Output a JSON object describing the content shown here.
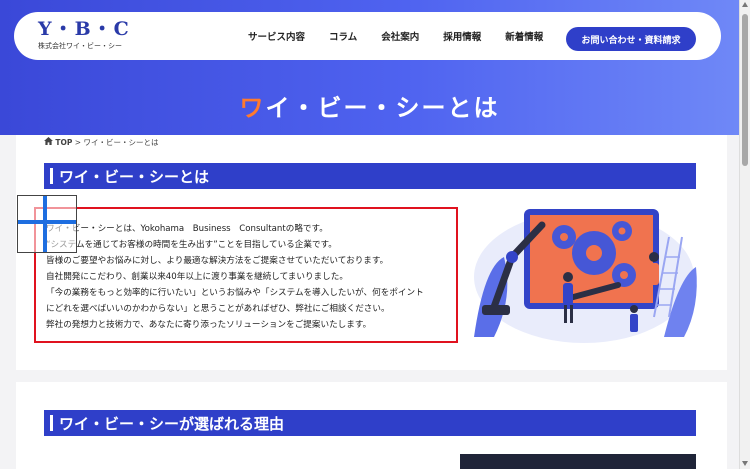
{
  "header": {
    "logo_main": "Y・B・C",
    "logo_sub": "株式会社ワイ・ビー・シー",
    "nav": [
      "サービス内容",
      "コラム",
      "会社案内",
      "採用情報",
      "新着情報"
    ],
    "contact_label": "お問い合わせ・資料請求"
  },
  "hero": {
    "title_accent": "ワ",
    "title_rest": "イ・ビー・シーとは"
  },
  "breadcrumb": {
    "home": "TOP",
    "separator": ">",
    "current": "ワイ・ビー・シーとは"
  },
  "about": {
    "heading": "ワイ・ビー・シーとは",
    "lines": [
      "ワイ・ビー・シーとは、Yokohama　Business　Consultantの略です。",
      "“システムを通じてお客様の時間を生み出す”ことを目指している企業です。",
      "皆様のご要望やお悩みに対し、より最適な解決方法をご提案させていただいております。",
      "自社開発にこだわり、創業以来40年以上に渡り事業を継続してまいりました。",
      "「今の業務をもっと効率的に行いたい」というお悩みや「システムを導入したいが、何をポイント",
      "にどれを選べばいいのかわからない」と思うことがあればぜひ、弊社にご相談ください。",
      "弊社の発想力と技術力で、あなたに寄り添ったソリューションをご提案いたします。"
    ]
  },
  "reasons": {
    "heading": "ワイ・ビー・シーが選ばれる理由"
  },
  "colors": {
    "brand_blue": "#2f3fc9",
    "accent_orange": "#ff7a2e",
    "highlight_red": "#e0121f"
  },
  "icons": {
    "home": "home-icon",
    "cursor": "crosshair-cursor-icon"
  }
}
